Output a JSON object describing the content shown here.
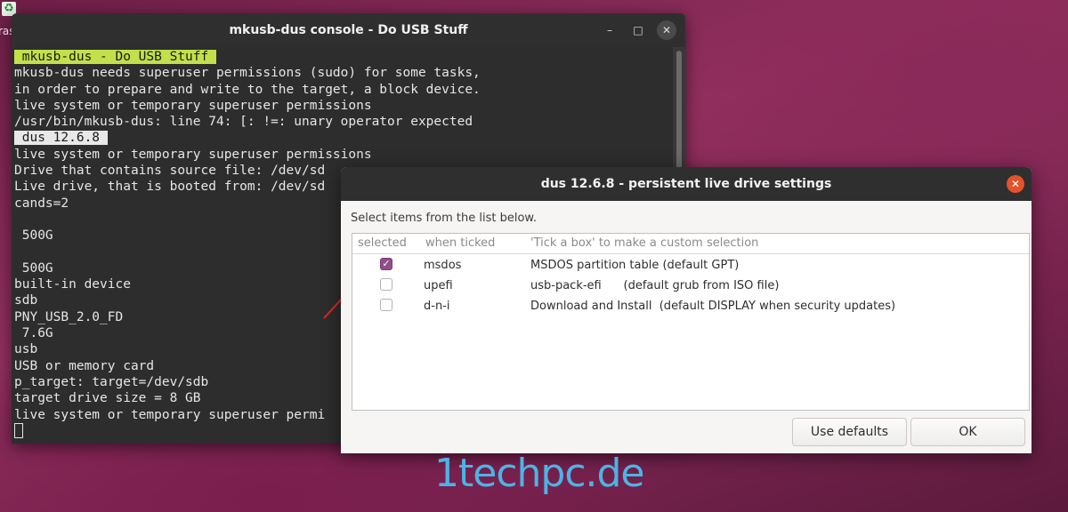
{
  "desktop": {
    "trash_label": "ras"
  },
  "terminal": {
    "title": "mkusb-dus console - Do USB Stuff",
    "controls": {
      "minimize": "–",
      "maximize": "□",
      "close": "✕"
    },
    "lines": [
      {
        "text": " mkusb-dus - Do USB Stuff ",
        "hl": "green"
      },
      {
        "text": "mkusb-dus needs superuser permissions (sudo) for some tasks,"
      },
      {
        "text": "in order to prepare and write to the target, a block device."
      },
      {
        "text": "live system or temporary superuser permissions"
      },
      {
        "text": "/usr/bin/mkusb-dus: line 74: [: !=: unary operator expected"
      },
      {
        "text": " dus 12.6.8 ",
        "hl": "white"
      },
      {
        "text": "live system or temporary superuser permissions"
      },
      {
        "text": "Drive that contains source file: /dev/sd"
      },
      {
        "text": "Live drive, that is booted from: /dev/sd"
      },
      {
        "text": "cands=2"
      },
      {
        "text": ""
      },
      {
        "text": " 500G"
      },
      {
        "text": ""
      },
      {
        "text": " 500G"
      },
      {
        "text": "built-in device"
      },
      {
        "text": "sdb"
      },
      {
        "text": "PNY_USB_2.0_FD"
      },
      {
        "text": " 7.6G"
      },
      {
        "text": "usb"
      },
      {
        "text": "USB or memory card"
      },
      {
        "text": "p_target: target=/dev/sdb"
      },
      {
        "text": "target drive size = 8 GB"
      },
      {
        "text": "live system or temporary superuser permi"
      },
      {
        "text": "",
        "cursor": true
      }
    ]
  },
  "dialog": {
    "title": "dus 12.6.8 - persistent live drive settings",
    "close_glyph": "✕",
    "prompt": "Select items from the list below.",
    "columns": [
      "selected",
      "when ticked",
      "'Tick a box' to make a custom selection"
    ],
    "rows": [
      {
        "checked": true,
        "name": "msdos",
        "desc": "MSDOS partition table (default GPT)"
      },
      {
        "checked": false,
        "name": "upefi",
        "desc": "usb-pack-efi      (default grub from ISO file)"
      },
      {
        "checked": false,
        "name": "d-n-i",
        "desc": "Download and Install  (default DISPLAY when security updates)"
      }
    ],
    "buttons": {
      "defaults": "Use defaults",
      "ok": "OK"
    },
    "accent_color": "#924d8b"
  },
  "watermark": "1techpc.de"
}
